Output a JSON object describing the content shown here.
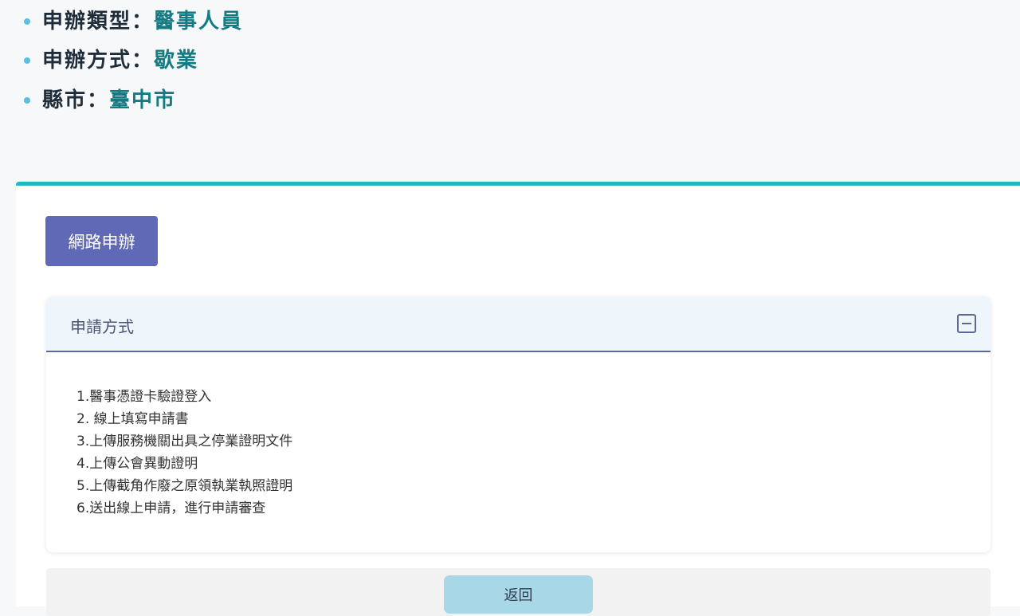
{
  "summary": [
    {
      "label": "申辦類型：",
      "value": "醫事人員"
    },
    {
      "label": "申辦方式：",
      "value": "歇業"
    },
    {
      "label": "縣市：",
      "value": "臺中市"
    }
  ],
  "online_button_label": "網路申辦",
  "accordion": {
    "title": "申請方式",
    "steps": [
      "1.醫事憑證卡驗證登入",
      "2. 線上填寫申請書",
      "3.上傳服務機關出具之停業證明文件",
      "4.上傳公會異動證明",
      "5.上傳截角作廢之原領執業執照證明",
      "6.送出線上申請，進行申請審查"
    ]
  },
  "back_button_label": "返回",
  "colors": {
    "accent": "#1fb8c3",
    "primary_button": "#5f69b6",
    "back_button": "#a8d8e8",
    "highlight": "#a8eef7",
    "value_text": "#147b83"
  },
  "icons": {
    "collapse": "minus-square-icon",
    "bullet": "dot-bullet-icon"
  }
}
